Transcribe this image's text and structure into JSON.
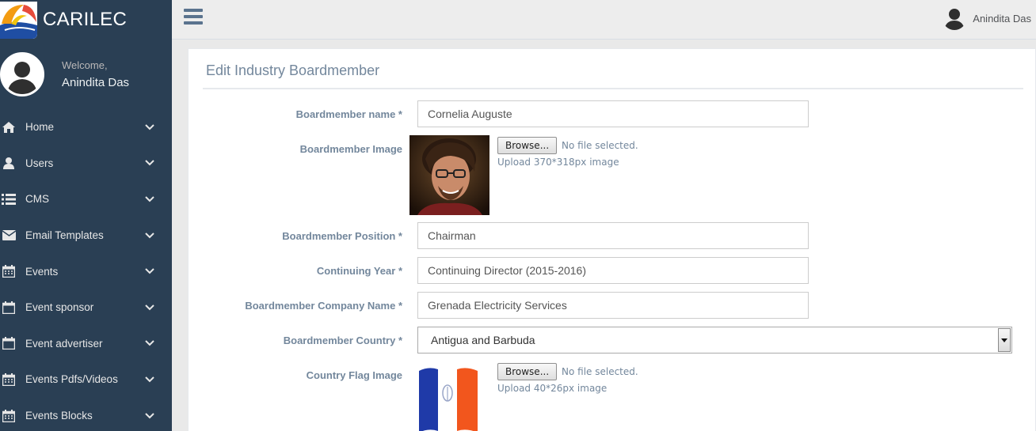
{
  "brand": {
    "title": "CARILEC"
  },
  "profile": {
    "welcome": "Welcome,",
    "name": "Anindita Das"
  },
  "sidebar": {
    "items": [
      {
        "label": "Home",
        "icon": "home-icon"
      },
      {
        "label": "Users",
        "icon": "user-icon"
      },
      {
        "label": "CMS",
        "icon": "list-icon"
      },
      {
        "label": "Email Templates",
        "icon": "envelope-icon"
      },
      {
        "label": "Events",
        "icon": "calendar-icon"
      },
      {
        "label": "Event sponsor",
        "icon": "calendar-icon"
      },
      {
        "label": "Event advertiser",
        "icon": "calendar-icon"
      },
      {
        "label": "Events Pdfs/Videos",
        "icon": "calendar-icon"
      },
      {
        "label": "Events Blocks",
        "icon": "calendar-icon"
      }
    ]
  },
  "topbar": {
    "user_name": "Anindita Das"
  },
  "panel": {
    "title": "Edit Industry Boardmember"
  },
  "form": {
    "name_label": "Boardmember name *",
    "name_value": "Cornelia Auguste",
    "image_label": "Boardmember Image",
    "browse_label": "Browse...",
    "no_file": "No file selected.",
    "image_hint": "Upload 370*318px image",
    "position_label": "Boardmember Position *",
    "position_value": "Chairman",
    "year_label": "Continuing Year *",
    "year_value": "Continuing Director (2015-2016)",
    "company_label": "Boardmember Company Name *",
    "company_value": "Grenada Electricity Services",
    "country_label": "Boardmember Country *",
    "country_value": "Antigua and Barbuda",
    "flag_label": "Country Flag Image",
    "flag_browse_label": "Browse...",
    "flag_no_file": "No file selected.",
    "flag_hint": "Upload 40*26px image"
  },
  "colors": {
    "sidebar_bg": "#2a3f54",
    "label": "#73879c",
    "topbar_bg": "#ededed"
  }
}
